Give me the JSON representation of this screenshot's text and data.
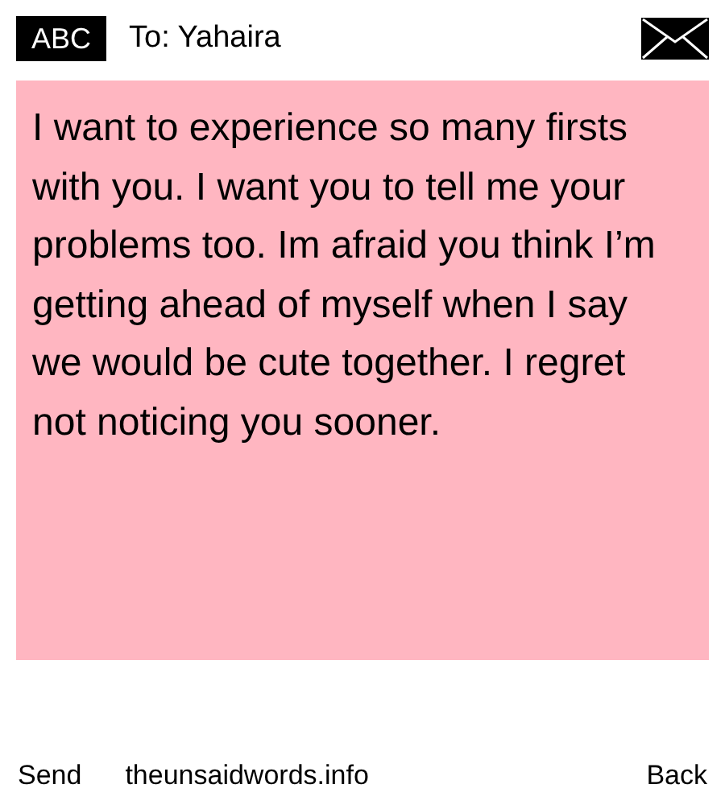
{
  "header": {
    "mode_badge": "ABC",
    "recipient": "To: Yahaira"
  },
  "message": "I want to experience so many firsts with you. I want you to tell me your problems too. Im afraid you think I’m getting ahead of myself when I say we would be cute together. I regret not noticing you sooner.",
  "footer": {
    "left": "Send",
    "site": "theunsaidwords.info",
    "right": "Back"
  }
}
